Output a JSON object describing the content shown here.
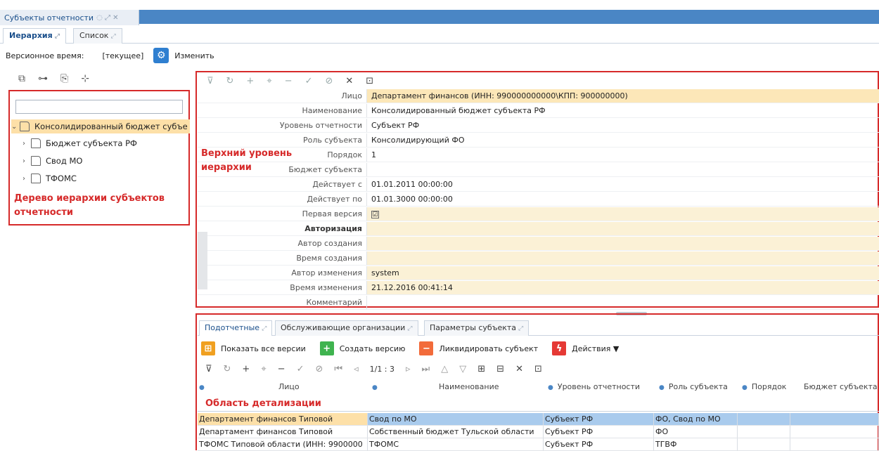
{
  "window": {
    "doc_tab_label": "Субъекты отчетности"
  },
  "subtabs": [
    {
      "label": "Иерархия",
      "active": true
    },
    {
      "label": "Список",
      "active": false
    }
  ],
  "version_bar": {
    "label": "Версионное время:",
    "value": "[текущее]",
    "change_label": "Изменить"
  },
  "tree": {
    "search_placeholder": "",
    "root": {
      "label": "Консолидированный бюджет субъе",
      "expanded": true,
      "selected": true
    },
    "children": [
      {
        "label": "Бюджет субъекта РФ"
      },
      {
        "label": "Свод МО"
      },
      {
        "label": "ТФОМС"
      }
    ],
    "annotation": "Дерево иерархии субъектов отчетности"
  },
  "form": {
    "annotation": "Верхний уровень иерархии",
    "rows": [
      {
        "label": "Лицо",
        "value": "Департамент финансов (ИНН: 990000000000\\КПП: 900000000)",
        "style": "hl"
      },
      {
        "label": "Наименование",
        "value": "Консолидированный бюджет субъекта РФ",
        "style": ""
      },
      {
        "label": "Уровень отчетности",
        "value": "Субъект РФ",
        "style": ""
      },
      {
        "label": "Роль субъекта",
        "value": "Консолидирующий ФО",
        "style": ""
      },
      {
        "label": "Порядок",
        "value": "1",
        "style": ""
      },
      {
        "label": "Бюджет субъекта",
        "value": "",
        "style": ""
      },
      {
        "label": "Действует с",
        "value": "01.01.2011 00:00:00",
        "style": ""
      },
      {
        "label": "Действует по",
        "value": "01.01.3000 00:00:00",
        "style": ""
      },
      {
        "label": "Первая версия",
        "value": "☑",
        "style": "hl2"
      },
      {
        "label": "Авторизация",
        "value": "",
        "style": "hl2",
        "bold": true
      },
      {
        "label": "Автор создания",
        "value": "",
        "style": "hl2"
      },
      {
        "label": "Время создания",
        "value": "",
        "style": "hl2"
      },
      {
        "label": "Автор изменения",
        "value": "system",
        "style": "hl2"
      },
      {
        "label": "Время изменения",
        "value": "21.12.2016 00:41:14",
        "style": "hl2"
      },
      {
        "label": "Комментарий",
        "value": "",
        "style": ""
      }
    ]
  },
  "bottom_tabs": [
    {
      "label": "Подотчетные",
      "active": true
    },
    {
      "label": "Обслуживающие организации",
      "active": false
    },
    {
      "label": "Параметры субъекта",
      "active": false
    }
  ],
  "actions": [
    {
      "label": "Показать все версии",
      "color": "#f0a020",
      "glyph": "⊞"
    },
    {
      "label": "Создать версию",
      "color": "#3fb34f",
      "glyph": "+"
    },
    {
      "label": "Ликвидировать субъект",
      "color": "#f26b3a",
      "glyph": "−"
    },
    {
      "label": "Действия ▼",
      "color": "#e53935",
      "glyph": "ϟ"
    }
  ],
  "pager": {
    "text": "1/1 : 3"
  },
  "grid": {
    "annotation": "Область детализации",
    "columns": [
      "Лицо",
      "Наименование",
      "Уровень отчетности",
      "Роль субъекта",
      "Порядок",
      "Бюджет субъекта"
    ],
    "rows": [
      [
        "Департамент финансов Типовой",
        "Свод по МО",
        "Субъект РФ",
        "ФО, Свод по МО",
        "",
        ""
      ],
      [
        "Департамент финансов Типовой",
        "Собственный бюджет Тульской области",
        "Субъект РФ",
        "ФО",
        "",
        ""
      ],
      [
        "ТФОМС Типовой области (ИНН: 9900000",
        "ТФОМС",
        "Субъект РФ",
        "ТГВФ",
        "",
        ""
      ]
    ]
  }
}
